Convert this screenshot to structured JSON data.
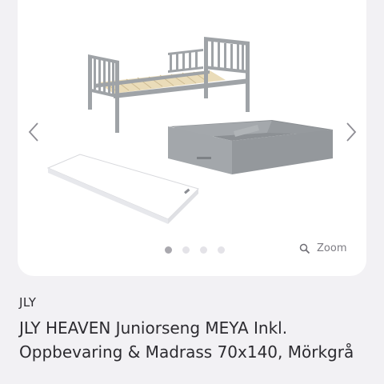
{
  "gallery": {
    "zoom_label": "Zoom",
    "slide_count": 4,
    "active_slide": 1,
    "icons": [
      "chevron-left-icon",
      "chevron-right-icon",
      "search-icon"
    ]
  },
  "product": {
    "brand": "JLY",
    "title": "JLY HEAVEN Juniorseng MEYA Inkl. Oppbevaring & Madrass 70x140, Mörkgrå"
  },
  "colors": {
    "background": "#f2f1f4",
    "card": "#ffffff",
    "bed_grey": "#9b9fa3",
    "slat_wood": "#e8d9b5",
    "text": "#2c2b30",
    "muted": "#7d7c83"
  }
}
